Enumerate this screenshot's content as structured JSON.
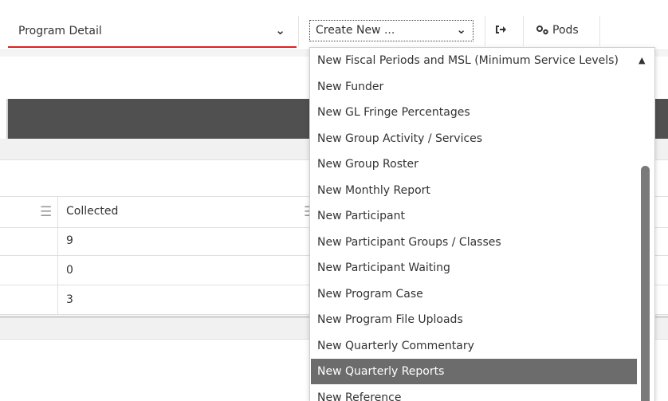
{
  "toolbar": {
    "program_select": {
      "label": "Program Detail"
    },
    "create_select": {
      "label": "Create New ..."
    },
    "pods_label": "Pods"
  },
  "table": {
    "header": {
      "collected": "Collected"
    },
    "rows": [
      {
        "collected": "9"
      },
      {
        "collected": "0"
      },
      {
        "collected": "3"
      }
    ]
  },
  "dropdown": {
    "options": [
      "New Fiscal Periods and MSL (Minimum Service Levels)",
      "New Funder",
      "New GL Fringe Percentages",
      "New Group Activity / Services",
      "New Group Roster",
      "New Monthly Report",
      "New Participant",
      "New Participant Groups / Classes",
      "New Participant Waiting",
      "New Program Case",
      "New Program File Uploads",
      "New Quarterly Commentary",
      "New Quarterly Reports",
      "New Reference"
    ],
    "selected": "New Quarterly Reports"
  },
  "colors": {
    "accent_red": "#e02020",
    "dark_band": "#505050",
    "selected_option": "#6c6c6c"
  }
}
